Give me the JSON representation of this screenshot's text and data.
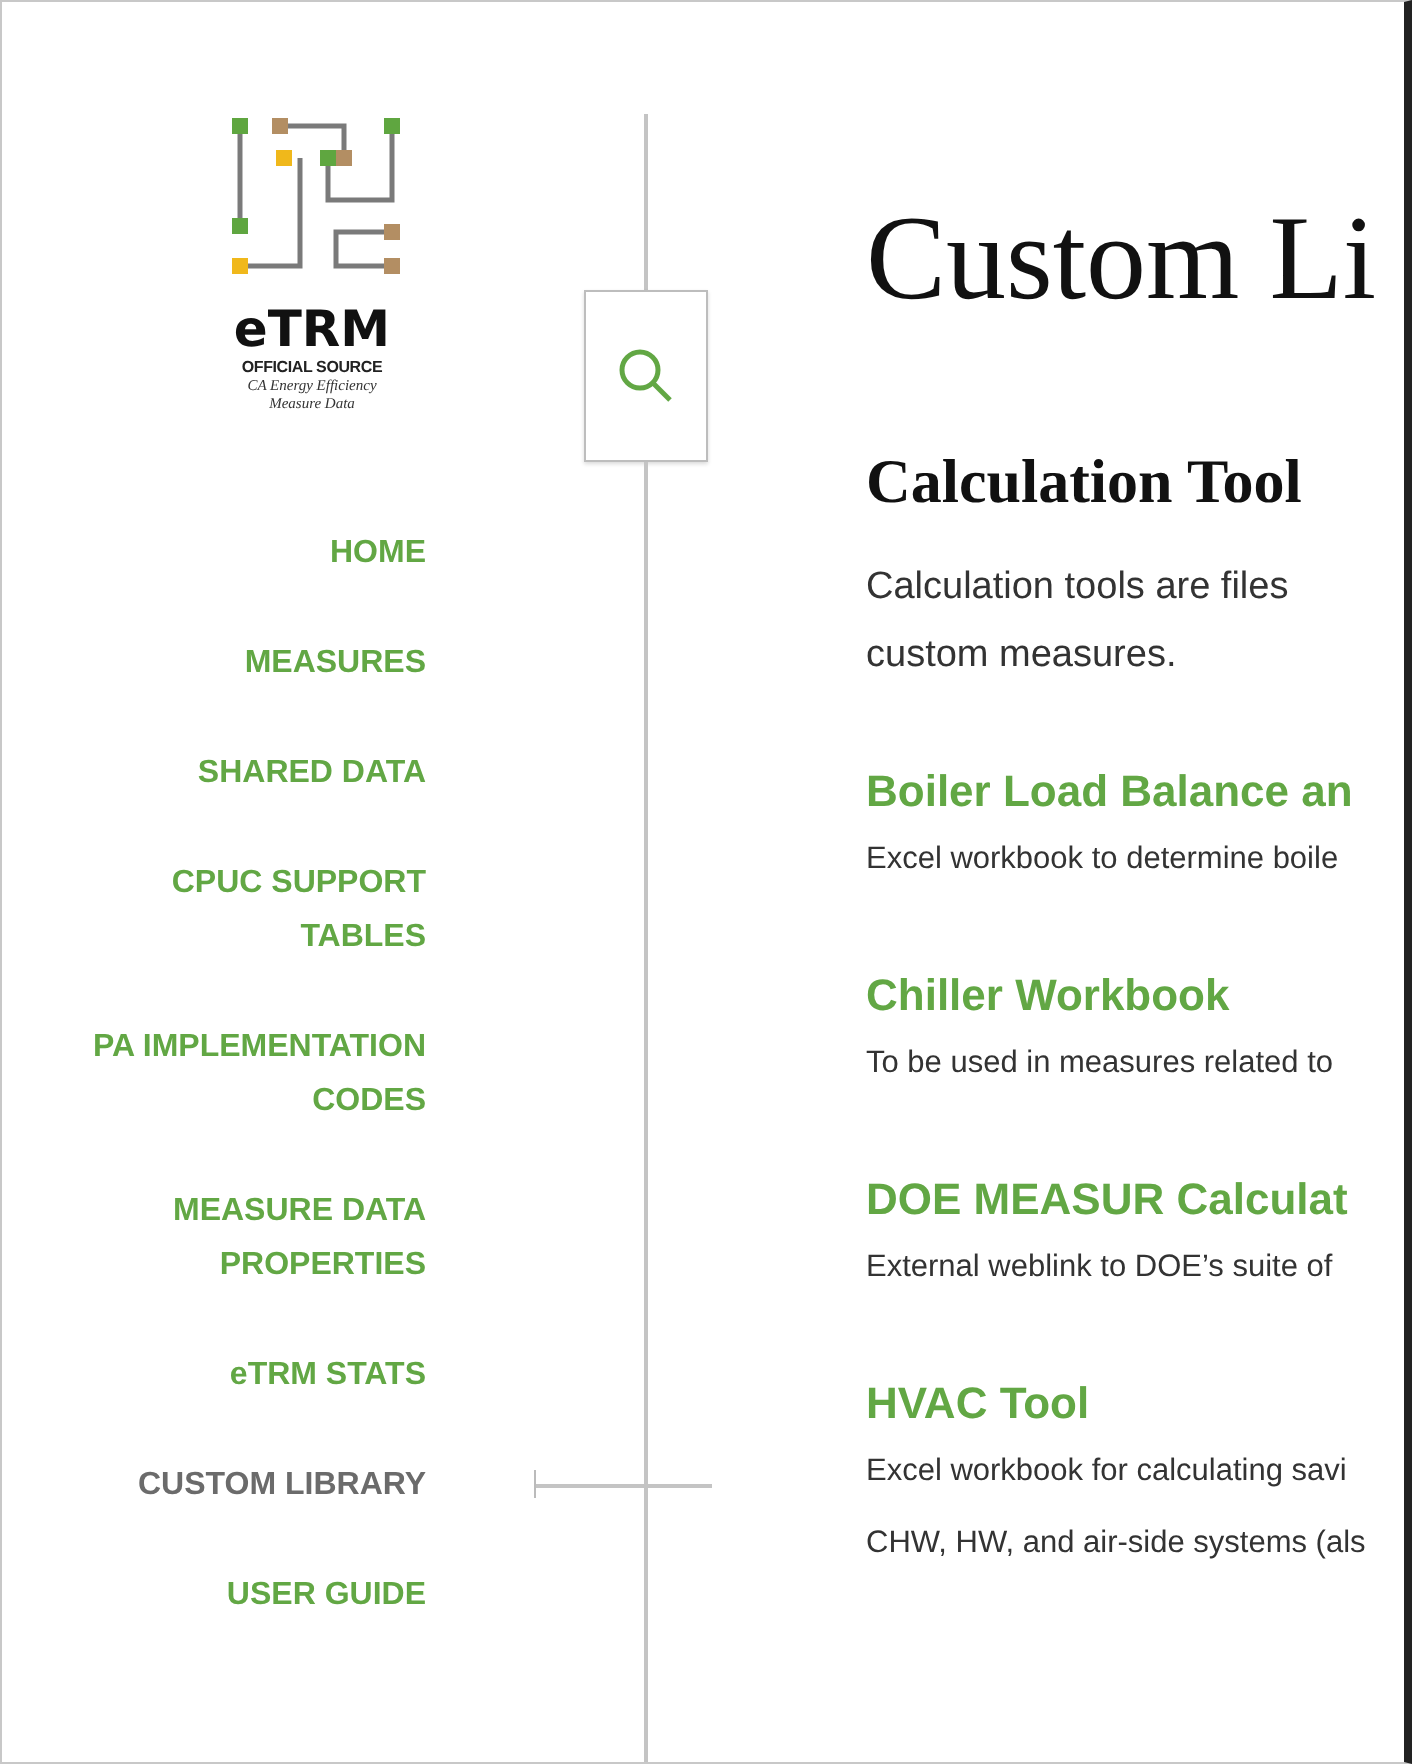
{
  "logo": {
    "name": "eTRM",
    "tagline": "OFFICIAL SOURCE",
    "subtitle_lines": [
      "CA Energy Efficiency",
      "Measure Data"
    ]
  },
  "nav": [
    {
      "label": "HOME",
      "selected": false
    },
    {
      "label": "MEASURES",
      "selected": false
    },
    {
      "label": "SHARED DATA",
      "selected": false
    },
    {
      "label": "CPUC SUPPORT TABLES",
      "selected": false
    },
    {
      "label": "PA IMPLEMENTATION CODES",
      "selected": false
    },
    {
      "label": "MEASURE DATA PROPERTIES",
      "selected": false
    },
    {
      "label": "eTRM STATS",
      "selected": false
    },
    {
      "label": "CUSTOM LIBRARY",
      "selected": true
    },
    {
      "label": "USER GUIDE",
      "selected": false
    }
  ],
  "page_title": "Custom Li",
  "section": {
    "title": "Calculation Tool",
    "intro_lines": [
      "Calculation tools are files",
      "custom measures."
    ],
    "tools": [
      {
        "title": "Boiler Load Balance an",
        "description_lines": [
          "Excel workbook to determine boile"
        ]
      },
      {
        "title": "Chiller Workbook",
        "description_lines": [
          "To be used in measures related to"
        ]
      },
      {
        "title": "DOE MEASUR Calculat",
        "description_lines": [
          "External weblink to DOE’s suite of"
        ]
      },
      {
        "title": "HVAC Tool",
        "description_lines": [
          "Excel workbook for calculating savi",
          "CHW, HW, and air-side systems (als"
        ]
      }
    ]
  }
}
